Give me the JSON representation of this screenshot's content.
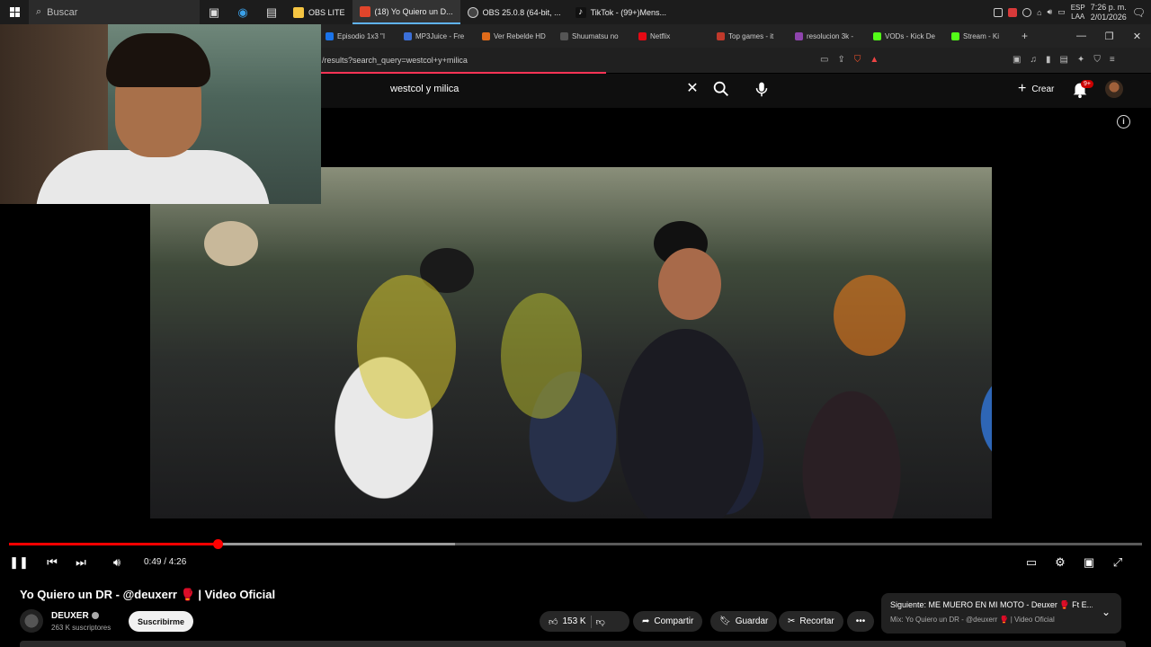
{
  "taskbar": {
    "search_placeholder": "Buscar",
    "apps": [
      {
        "label": "OBS LITE",
        "color": "#f5c542"
      },
      {
        "label": "(18) Yo Quiero un D...",
        "color": "#e0452b",
        "active": true
      },
      {
        "label": "OBS 25.0.8 (64-bit, ...",
        "color": "#444444"
      },
      {
        "label": "TikTok - (99+)Mens...",
        "color": "#111111"
      }
    ],
    "lang_top": "ESP",
    "lang_bottom": "LAA",
    "time": "7:26 p. m.",
    "date": "2/01/2026"
  },
  "bookmarks": [
    {
      "label": "Episodio 1x3 \"I",
      "color": "#1a73e8"
    },
    {
      "label": "MP3Juice - Fre",
      "color": "#3b6fd8"
    },
    {
      "label": "Ver Rebelde HD",
      "color": "#e06b1a"
    },
    {
      "label": "Shuumatsu no",
      "color": "#333333"
    },
    {
      "label": "Netflix",
      "color": "#e50914"
    },
    {
      "label": "Top games - it",
      "color": "#c0392b"
    },
    {
      "label": "resolucion 3k -",
      "color": "#8e44ad"
    },
    {
      "label": "VODs - Kick De",
      "color": "#53fc18"
    },
    {
      "label": "Stream - Ki",
      "color": "#53fc18"
    }
  ],
  "browser": {
    "url": "/results?search_query=westcol+y+milica"
  },
  "youtube": {
    "search_value": "westcol y milica",
    "create_label": "Crear",
    "notifications_badge": "9+",
    "player": {
      "progress_fraction": 0.184,
      "buffer_fraction": 0.394,
      "time_display": "0:49 / 4:26"
    },
    "video": {
      "title": "Yo Quiero un DR - @deuxerr 🥊 | Video Oficial",
      "channel": "DEUXER",
      "subscribers": "263 K suscriptores",
      "subscribe_label": "Suscribirme",
      "likes": "153 K",
      "share_label": "Compartir",
      "save_label": "Guardar",
      "clip_label": "Recortar"
    },
    "up_next": {
      "line1": "Siguiente: ME MUERO EN MI MOTO - Deuxer 🥊 Ft E...",
      "line2": "Mix: Yo Quiero un DR - @deuxerr 🥊 | Video Oficial"
    }
  },
  "colors": {
    "accent": "#ff0000",
    "background": "#0f0f0f",
    "taskbar": "#1c1c1c"
  }
}
